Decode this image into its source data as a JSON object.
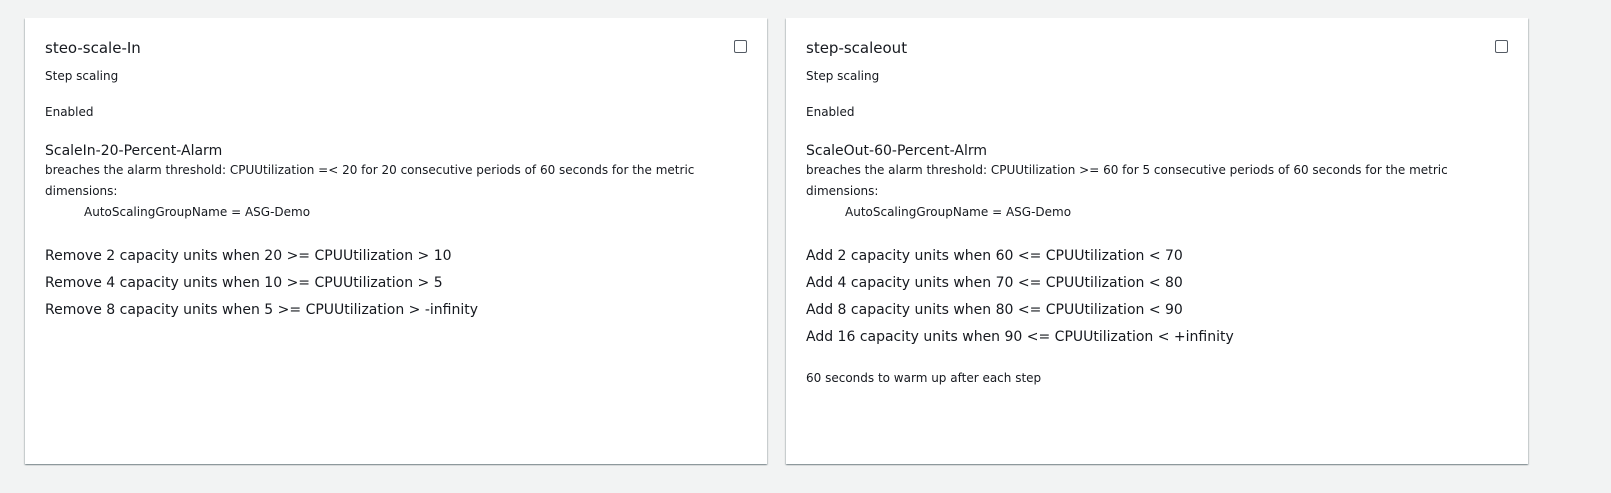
{
  "policies": [
    {
      "name": "steo-scale-In",
      "type": "Step scaling",
      "status": "Enabled",
      "alarm_name": "ScaleIn-20-Percent-Alarm",
      "alarm_description": "breaches the alarm threshold: CPUUtilization =< 20 for 20 consecutive periods of 60 seconds for the metric dimensions:",
      "dimension": "AutoScalingGroupName = ASG-Demo",
      "steps": [
        "Remove 2 capacity units when 20 >= CPUUtilization > 10",
        "Remove 4 capacity units when 10 >= CPUUtilization > 5",
        "Remove 8 capacity units when 5 >= CPUUtilization > -infinity"
      ],
      "checked": false
    },
    {
      "name": "step-scaleout",
      "type": "Step scaling",
      "status": "Enabled",
      "alarm_name": "ScaleOut-60-Percent-Alrm",
      "alarm_description": "breaches the alarm threshold: CPUUtilization >= 60 for 5 consecutive periods of 60 seconds for the metric dimensions:",
      "dimension": "AutoScalingGroupName = ASG-Demo",
      "steps": [
        "Add 2 capacity units when 60 <= CPUUtilization < 70",
        "Add 4 capacity units when 70 <= CPUUtilization < 80",
        "Add 8 capacity units when 80 <= CPUUtilization < 90",
        "Add 16 capacity units when 90 <= CPUUtilization < +infinity"
      ],
      "warmup": "60 seconds to warm up after each step",
      "checked": false
    }
  ]
}
